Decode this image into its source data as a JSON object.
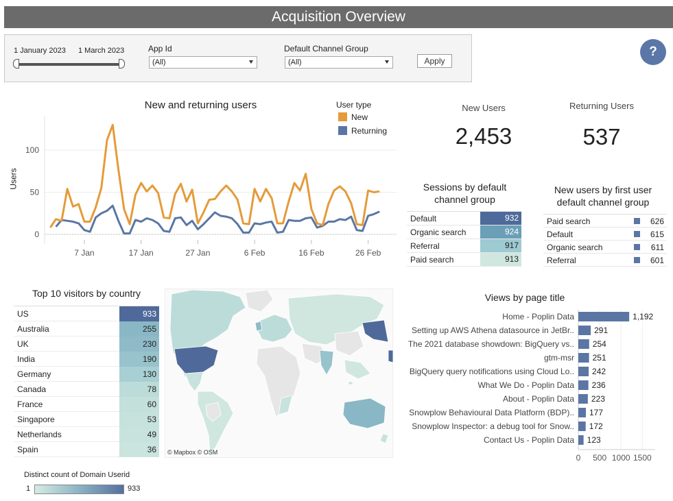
{
  "header": {
    "title": "Acquisition Overview"
  },
  "filters": {
    "date_start": "1 January 2023",
    "date_end": "1 March 2023",
    "app_id_label": "App Id",
    "app_id_value": "(All)",
    "channel_label": "Default Channel Group",
    "channel_value": "(All)",
    "apply_label": "Apply"
  },
  "help": {
    "label": "?"
  },
  "kpis": {
    "new_users_label": "New Users",
    "new_users_value": "2,453",
    "returning_users_label": "Returning Users",
    "returning_users_value": "537"
  },
  "colors": {
    "new": "#e49b3a",
    "returning": "#5b76a5"
  },
  "sessions": {
    "title_line1": "Sessions by default",
    "title_line2": "channel group",
    "rows": [
      {
        "label": "Default",
        "value": "932",
        "color": "#4e6a9a",
        "text_color": "#ffffff"
      },
      {
        "label": "Organic search",
        "value": "924",
        "color": "#6a9fb7",
        "text_color": "#ffffff"
      },
      {
        "label": "Referral",
        "value": "917",
        "color": "#9ecad2",
        "text_color": "#222222"
      },
      {
        "label": "Paid search",
        "value": "913",
        "color": "#cfe7df",
        "text_color": "#222222"
      }
    ]
  },
  "new_users_channel": {
    "title_line1": "New users by first user",
    "title_line2": "default channel group",
    "rows": [
      {
        "label": "Paid search",
        "value": "626"
      },
      {
        "label": "Default",
        "value": "615"
      },
      {
        "label": "Organic search",
        "value": "611"
      },
      {
        "label": "Referral",
        "value": "601"
      }
    ]
  },
  "countries": {
    "title": "Top 10 visitors by country",
    "rows": [
      {
        "label": "US",
        "value": "933",
        "color": "#4f6a9a",
        "text_color": "#ffffff"
      },
      {
        "label": "Australia",
        "value": "255",
        "color": "#8ab7c5",
        "text_color": "#222222"
      },
      {
        "label": "UK",
        "value": "230",
        "color": "#8fbbc8",
        "text_color": "#222222"
      },
      {
        "label": "India",
        "value": "190",
        "color": "#98c2cc",
        "text_color": "#222222"
      },
      {
        "label": "Germany",
        "value": "130",
        "color": "#a8cfd3",
        "text_color": "#222222"
      },
      {
        "label": "Canada",
        "value": "78",
        "color": "#bcdcd9",
        "text_color": "#222222"
      },
      {
        "label": "France",
        "value": "60",
        "color": "#c3e0db",
        "text_color": "#222222"
      },
      {
        "label": "Singapore",
        "value": "53",
        "color": "#c6e2dc",
        "text_color": "#222222"
      },
      {
        "label": "Netherlands",
        "value": "49",
        "color": "#c8e3dd",
        "text_color": "#222222"
      },
      {
        "label": "Spain",
        "value": "36",
        "color": "#cae4de",
        "text_color": "#222222"
      }
    ]
  },
  "map": {
    "attribution": "© Mapbox  © OSM"
  },
  "legend_scale": {
    "title": "Distinct count of Domain Userid",
    "min": "1",
    "max": "933"
  },
  "chart_data": [
    {
      "type": "line",
      "title": "New and returning users",
      "ylabel": "Users",
      "xlabel": "",
      "legend_title": "User type",
      "legend_position": "top-right",
      "ylim": [
        -5,
        140
      ],
      "xlim": [
        "2022-12-31",
        "2023-03-03"
      ],
      "yticks": [
        0,
        50,
        100
      ],
      "xtick_labels": [
        "7 Jan",
        "17 Jan",
        "27 Jan",
        "6 Feb",
        "16 Feb",
        "26 Feb"
      ],
      "xtick_dates": [
        "2023-01-07",
        "2023-01-17",
        "2023-01-27",
        "2023-02-06",
        "2023-02-16",
        "2023-02-26"
      ],
      "x": [
        "2023-01-01",
        "2023-01-02",
        "2023-01-03",
        "2023-01-04",
        "2023-01-05",
        "2023-01-06",
        "2023-01-07",
        "2023-01-08",
        "2023-01-09",
        "2023-01-10",
        "2023-01-11",
        "2023-01-12",
        "2023-01-13",
        "2023-01-14",
        "2023-01-15",
        "2023-01-16",
        "2023-01-17",
        "2023-01-18",
        "2023-01-19",
        "2023-01-20",
        "2023-01-21",
        "2023-01-22",
        "2023-01-23",
        "2023-01-24",
        "2023-01-25",
        "2023-01-26",
        "2023-01-27",
        "2023-01-28",
        "2023-01-29",
        "2023-01-30",
        "2023-01-31",
        "2023-02-01",
        "2023-02-02",
        "2023-02-03",
        "2023-02-04",
        "2023-02-05",
        "2023-02-06",
        "2023-02-07",
        "2023-02-08",
        "2023-02-09",
        "2023-02-10",
        "2023-02-11",
        "2023-02-12",
        "2023-02-13",
        "2023-02-14",
        "2023-02-15",
        "2023-02-16",
        "2023-02-17",
        "2023-02-18",
        "2023-02-19",
        "2023-02-20",
        "2023-02-21",
        "2023-02-22",
        "2023-02-23",
        "2023-02-24",
        "2023-02-25",
        "2023-02-26",
        "2023-02-27",
        "2023-02-28",
        "2023-03-01"
      ],
      "series": [
        {
          "name": "New",
          "values": [
            8,
            18,
            16,
            54,
            33,
            36,
            15,
            15,
            32,
            55,
            112,
            130,
            77,
            30,
            12,
            47,
            61,
            51,
            58,
            49,
            20,
            19,
            48,
            60,
            39,
            53,
            13,
            26,
            41,
            42,
            51,
            58,
            51,
            41,
            13,
            12,
            54,
            39,
            54,
            43,
            13,
            13,
            39,
            61,
            52,
            72,
            30,
            13,
            11,
            36,
            52,
            57,
            51,
            37,
            12,
            11,
            52,
            50,
            51
          ]
        },
        {
          "name": "Returning",
          "values": [
            null,
            9,
            17,
            16,
            15,
            13,
            5,
            3,
            20,
            25,
            28,
            34,
            16,
            1,
            1,
            17,
            15,
            19,
            17,
            13,
            4,
            3,
            19,
            20,
            11,
            16,
            6,
            12,
            19,
            26,
            22,
            21,
            19,
            12,
            2,
            2,
            13,
            12,
            14,
            15,
            2,
            3,
            17,
            16,
            16,
            19,
            20,
            8,
            10,
            15,
            15,
            18,
            17,
            21,
            5,
            4,
            22,
            24,
            27
          ]
        }
      ]
    },
    {
      "type": "bar",
      "orientation": "horizontal",
      "title": "Views by page title",
      "categories": [
        "Home - Poplin Data",
        "Setting up AWS Athena datasource in JetBr..",
        "The 2021 database showdown: BigQuery vs..",
        "gtm-msr",
        "BigQuery query notifications using Cloud Lo..",
        "What We Do - Poplin Data",
        "About - Poplin Data",
        "Snowplow Behavioural Data Platform (BDP)..",
        "Snowplow Inspector: a debug tool for Snow..",
        "Contact Us - Poplin Data"
      ],
      "values": [
        1192,
        291,
        254,
        251,
        242,
        236,
        223,
        177,
        172,
        123
      ],
      "value_labels": [
        "1,192",
        "291",
        "254",
        "251",
        "242",
        "236",
        "223",
        "177",
        "172",
        "123"
      ],
      "xlim": [
        0,
        1800
      ],
      "xticks": [
        0,
        500,
        1000,
        1500
      ],
      "color": "#5b76a5"
    }
  ]
}
